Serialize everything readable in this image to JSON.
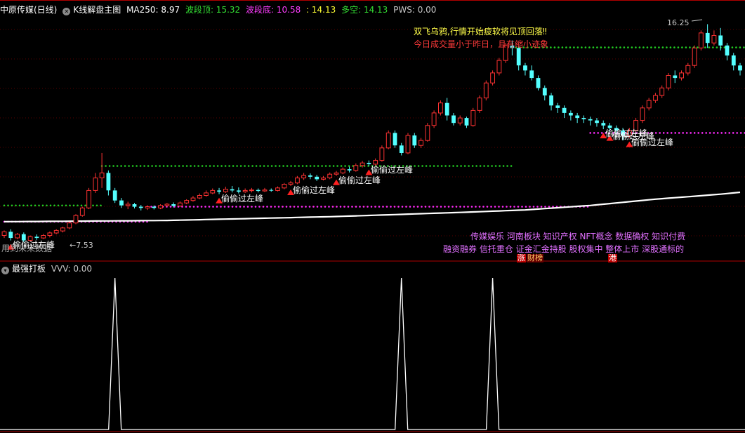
{
  "main_header": {
    "title": "中原传媒(日线)",
    "indicator_name": "K线解盘主图",
    "ma250": "MA250: 8.97",
    "band_top": "波段顶: 15.32",
    "band_bottom": "波段底: 10.58",
    "bottom_value": ": 14.13",
    "long_short": "多空: 14.13",
    "pws": "PWS: 0.00"
  },
  "sub_header": {
    "title": "最强打板",
    "value": "VVV: 0.00"
  },
  "annotations": {
    "pattern": "双飞乌鸦,行情开始疲软将见顶回落‼",
    "volume": "今日成交量小于昨日，且有缩小迹象",
    "future_note": "用到未来数据",
    "low_price": "←7.53",
    "high_price": "16.25",
    "signal_label": "偷偷过左峰",
    "concepts_line1": "传媒娱乐 河南板块 知识产权 NFT概念 数据确权 知识付费",
    "concepts_line2": "融资融券 信托重仓 证金汇金持股 股权集中 整体上市 深股通标的",
    "tag_zhang": "涨",
    "tag_caibang": "财榜",
    "tag_gang": "港"
  },
  "colors": {
    "up": "#ff3232",
    "down": "#54ffff",
    "ma": "#ffffff",
    "green_dots": "#22cc22",
    "magenta_dots": "#ff2bff",
    "pattern_text": "#ffff4a",
    "warn_text": "#ff3a3a",
    "concept_text": "#e070ff",
    "grid": "#5a0000",
    "sub_line": "#ffffff"
  },
  "chart_data": {
    "type": "candlestick",
    "price_scale_reference": {
      "low": 7.53,
      "high": 16.25
    },
    "candles": [
      [
        7.8,
        7.95,
        7.7,
        8.0
      ],
      [
        7.95,
        7.7,
        7.6,
        8.05
      ],
      [
        7.7,
        7.85,
        7.65,
        7.9
      ],
      [
        7.85,
        7.6,
        7.53,
        7.92
      ],
      [
        7.6,
        7.75,
        7.55,
        7.8
      ],
      [
        7.75,
        7.7,
        7.62,
        7.84
      ],
      [
        7.7,
        7.8,
        7.66,
        7.86
      ],
      [
        7.8,
        7.9,
        7.72,
        7.96
      ],
      [
        7.9,
        8.0,
        7.85,
        8.05
      ],
      [
        7.98,
        8.1,
        7.92,
        8.15
      ],
      [
        8.1,
        8.3,
        8.05,
        8.35
      ],
      [
        8.3,
        8.6,
        8.25,
        8.65
      ],
      [
        8.6,
        8.9,
        8.55,
        8.95
      ],
      [
        8.9,
        9.6,
        8.85,
        9.7
      ],
      [
        9.6,
        10.1,
        9.5,
        10.3
      ],
      [
        10.1,
        10.3,
        9.7,
        11.1
      ],
      [
        10.3,
        9.6,
        9.4,
        10.4
      ],
      [
        9.6,
        9.2,
        9.1,
        9.7
      ],
      [
        9.2,
        9.0,
        8.9,
        9.3
      ],
      [
        9.0,
        9.05,
        8.85,
        9.15
      ],
      [
        9.05,
        8.95,
        8.88,
        9.1
      ],
      [
        8.95,
        8.9,
        8.8,
        9.02
      ],
      [
        8.9,
        8.95,
        8.82,
        9.0
      ],
      [
        8.95,
        8.9,
        8.84,
        9.0
      ],
      [
        8.9,
        9.0,
        8.85,
        9.05
      ],
      [
        9.0,
        9.05,
        8.95,
        9.1
      ],
      [
        9.05,
        8.98,
        8.92,
        9.12
      ],
      [
        8.98,
        9.1,
        8.94,
        9.16
      ],
      [
        9.1,
        9.2,
        9.05,
        9.25
      ],
      [
        9.2,
        9.3,
        9.15,
        9.38
      ],
      [
        9.3,
        9.4,
        9.25,
        9.48
      ],
      [
        9.4,
        9.5,
        9.35,
        9.6
      ],
      [
        9.5,
        9.6,
        9.45,
        9.68
      ],
      [
        9.6,
        9.55,
        9.45,
        9.7
      ],
      [
        9.55,
        9.65,
        9.5,
        9.75
      ],
      [
        9.65,
        9.6,
        9.52,
        9.78
      ],
      [
        9.6,
        9.55,
        9.48,
        9.72
      ],
      [
        9.55,
        9.6,
        9.5,
        9.68
      ],
      [
        9.6,
        9.62,
        9.52,
        9.7
      ],
      [
        9.62,
        9.58,
        9.52,
        9.68
      ],
      [
        9.58,
        9.62,
        9.54,
        9.7
      ],
      [
        9.62,
        9.6,
        9.55,
        9.68
      ],
      [
        9.6,
        9.7,
        9.56,
        9.76
      ],
      [
        9.7,
        9.85,
        9.65,
        9.9
      ],
      [
        9.85,
        9.9,
        9.78,
        9.98
      ],
      [
        9.9,
        10.1,
        9.85,
        10.18
      ],
      [
        10.1,
        10.2,
        10.02,
        10.3
      ],
      [
        10.2,
        10.15,
        10.05,
        10.28
      ],
      [
        10.15,
        10.05,
        9.98,
        10.22
      ],
      [
        10.05,
        10.1,
        10.0,
        10.18
      ],
      [
        10.1,
        10.25,
        10.05,
        10.32
      ],
      [
        10.25,
        10.3,
        10.18,
        10.38
      ],
      [
        10.3,
        10.45,
        10.25,
        10.52
      ],
      [
        10.45,
        10.4,
        10.32,
        10.55
      ],
      [
        10.4,
        10.6,
        10.35,
        10.68
      ],
      [
        10.6,
        10.7,
        10.52,
        10.78
      ],
      [
        10.7,
        10.65,
        10.58,
        10.8
      ],
      [
        10.65,
        10.8,
        10.6,
        10.88
      ],
      [
        10.8,
        11.3,
        10.75,
        11.4
      ],
      [
        11.3,
        11.9,
        11.25,
        12.0
      ],
      [
        11.9,
        11.4,
        11.3,
        12.0
      ],
      [
        11.4,
        11.1,
        11.0,
        11.5
      ],
      [
        11.1,
        11.8,
        11.05,
        11.9
      ],
      [
        11.8,
        11.4,
        11.3,
        11.9
      ],
      [
        11.4,
        11.6,
        11.3,
        11.7
      ],
      [
        11.6,
        12.2,
        11.55,
        12.3
      ],
      [
        12.2,
        12.7,
        12.1,
        12.8
      ],
      [
        12.7,
        13.1,
        12.6,
        13.2
      ],
      [
        13.1,
        12.6,
        12.4,
        13.3
      ],
      [
        12.6,
        12.3,
        12.2,
        12.7
      ],
      [
        12.3,
        12.5,
        12.2,
        12.6
      ],
      [
        12.5,
        12.2,
        12.1,
        12.55
      ],
      [
        12.2,
        12.8,
        12.15,
        12.9
      ],
      [
        12.8,
        13.3,
        12.7,
        13.4
      ],
      [
        13.3,
        13.9,
        13.2,
        14.0
      ],
      [
        13.9,
        14.3,
        13.8,
        14.4
      ],
      [
        14.3,
        14.8,
        14.2,
        14.9
      ],
      [
        14.8,
        15.4,
        14.7,
        15.5
      ],
      [
        15.4,
        15.3,
        15.0,
        15.6
      ],
      [
        15.3,
        14.6,
        14.4,
        15.35
      ],
      [
        14.6,
        14.4,
        14.2,
        14.7
      ],
      [
        14.4,
        14.1,
        14.0,
        14.6
      ],
      [
        14.1,
        13.7,
        13.6,
        14.2
      ],
      [
        13.7,
        13.4,
        13.2,
        13.8
      ],
      [
        13.4,
        13.0,
        12.8,
        13.5
      ],
      [
        13.0,
        12.9,
        12.7,
        13.1
      ],
      [
        12.9,
        12.7,
        12.5,
        13.0
      ],
      [
        12.7,
        12.6,
        12.4,
        12.8
      ],
      [
        12.6,
        12.5,
        12.3,
        12.7
      ],
      [
        12.5,
        12.45,
        12.3,
        12.6
      ],
      [
        12.45,
        12.4,
        12.2,
        12.55
      ],
      [
        12.4,
        12.3,
        12.15,
        12.5
      ],
      [
        12.3,
        12.2,
        12.05,
        12.4
      ],
      [
        12.2,
        12.1,
        11.95,
        12.3
      ],
      [
        12.1,
        12.0,
        11.85,
        12.2
      ],
      [
        12.0,
        11.8,
        11.6,
        12.1
      ],
      [
        11.8,
        12.0,
        11.7,
        12.1
      ],
      [
        12.0,
        12.4,
        11.95,
        12.5
      ],
      [
        12.4,
        12.9,
        12.3,
        13.0
      ],
      [
        12.9,
        13.2,
        12.8,
        13.3
      ],
      [
        13.2,
        13.4,
        13.1,
        13.5
      ],
      [
        13.4,
        13.7,
        13.3,
        13.8
      ],
      [
        13.7,
        14.2,
        13.6,
        14.3
      ],
      [
        14.2,
        14.1,
        13.9,
        14.4
      ],
      [
        14.1,
        14.3,
        14.0,
        14.4
      ],
      [
        14.3,
        14.6,
        14.2,
        14.7
      ],
      [
        14.6,
        15.3,
        14.5,
        15.4
      ],
      [
        15.3,
        15.9,
        15.2,
        16.0
      ],
      [
        15.9,
        15.5,
        15.3,
        16.25
      ],
      [
        15.5,
        15.8,
        15.4,
        16.0
      ],
      [
        15.8,
        15.4,
        15.2,
        16.1
      ],
      [
        15.4,
        15.0,
        14.8,
        15.5
      ],
      [
        15.0,
        14.6,
        14.4,
        15.1
      ],
      [
        14.6,
        14.4,
        14.2,
        14.7
      ]
    ],
    "ma250": [
      [
        0,
        8.35
      ],
      [
        25,
        8.4
      ],
      [
        50,
        8.55
      ],
      [
        70,
        8.72
      ],
      [
        80,
        8.82
      ],
      [
        90,
        9.0
      ],
      [
        100,
        9.25
      ],
      [
        110,
        9.45
      ],
      [
        114,
        9.55
      ]
    ],
    "resistance_green": [
      {
        "from": 0,
        "to": 15,
        "value": 9.0
      },
      {
        "from": 15,
        "to": 78,
        "value": 10.58
      },
      {
        "from": 78,
        "to": 114,
        "value": 15.32
      }
    ],
    "support_magenta": [
      {
        "from": 0,
        "to": 22,
        "value": 8.35
      },
      {
        "from": 22,
        "to": 90,
        "value": 8.95
      },
      {
        "from": 90,
        "to": 114,
        "value": 11.9
      }
    ],
    "signal_bars": [
      1,
      33,
      44,
      51,
      56,
      92,
      93,
      96
    ],
    "sub_indicator": {
      "name": "VVV",
      "spikes": [
        17,
        61,
        75
      ],
      "range": [
        0,
        1
      ]
    }
  }
}
